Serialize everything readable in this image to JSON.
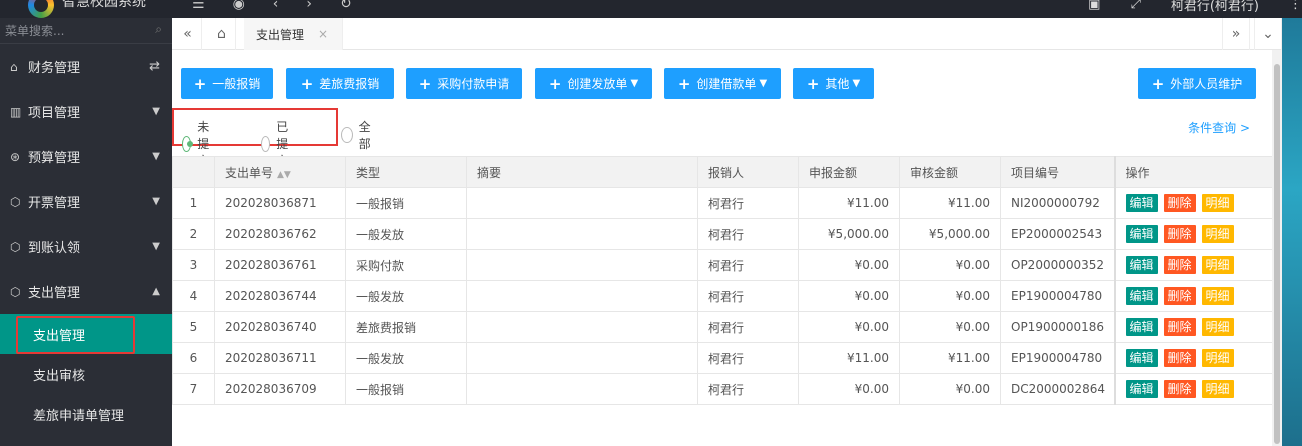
{
  "app": {
    "brand": "智慧校园系统",
    "user": "柯君行(柯君行)"
  },
  "sidebar": {
    "search_placeholder": "菜单搜索...",
    "items": [
      {
        "label": "财务管理",
        "icon": "home-icon"
      },
      {
        "label": "项目管理",
        "icon": "book-icon"
      },
      {
        "label": "预算管理",
        "icon": "coin-icon"
      },
      {
        "label": "开票管理",
        "icon": "cube-icon"
      },
      {
        "label": "到账认领",
        "icon": "cube-icon"
      },
      {
        "label": "支出管理",
        "icon": "cube-icon"
      }
    ],
    "subitems": [
      {
        "label": "支出管理",
        "active": true
      },
      {
        "label": "支出审核"
      },
      {
        "label": "差旅申请单管理"
      }
    ]
  },
  "tabs": [
    {
      "label": "支出管理"
    }
  ],
  "toolbar": {
    "btn_general": "一般报销",
    "btn_travel": "差旅费报销",
    "btn_purchase": "采购付款申请",
    "btn_create_pay": "创建发放单",
    "btn_create_loan": "创建借款单",
    "btn_other": "其他",
    "btn_external": "外部人员维护"
  },
  "filter": {
    "opt_unsubmitted": "未提交",
    "opt_submitted": "已提交",
    "opt_all": "全部",
    "selected": "未提交",
    "condition_query": "条件查询 >"
  },
  "table": {
    "headers": [
      "",
      "支出单号",
      "类型",
      "摘要",
      "报销人",
      "申报金额",
      "审核金额",
      "项目编号",
      "操作"
    ],
    "rows": [
      [
        "1",
        "202028036871",
        "一般报销",
        "",
        "柯君行",
        "¥11.00",
        "¥11.00",
        "NI2000000792"
      ],
      [
        "2",
        "202028036762",
        "一般发放",
        "",
        "柯君行",
        "¥5,000.00",
        "¥5,000.00",
        "EP2000002543"
      ],
      [
        "3",
        "202028036761",
        "采购付款",
        "",
        "柯君行",
        "¥0.00",
        "¥0.00",
        "OP2000000352"
      ],
      [
        "4",
        "202028036744",
        "一般发放",
        "",
        "柯君行",
        "¥0.00",
        "¥0.00",
        "EP1900004780"
      ],
      [
        "5",
        "202028036740",
        "差旅费报销",
        "",
        "柯君行",
        "¥0.00",
        "¥0.00",
        "OP1900000186"
      ],
      [
        "6",
        "202028036711",
        "一般发放",
        "",
        "柯君行",
        "¥11.00",
        "¥11.00",
        "EP1900004780"
      ],
      [
        "7",
        "202028036709",
        "一般报销",
        "",
        "柯君行",
        "¥0.00",
        "¥0.00",
        "DC2000002864"
      ]
    ],
    "ops": {
      "edit": "编辑",
      "delete": "删除",
      "detail": "明细"
    }
  },
  "colors": {
    "primary": "#1e9fff",
    "teal": "#009688",
    "danger": "#ff5722",
    "warn": "#ffb800",
    "highlight": "#e53935"
  }
}
